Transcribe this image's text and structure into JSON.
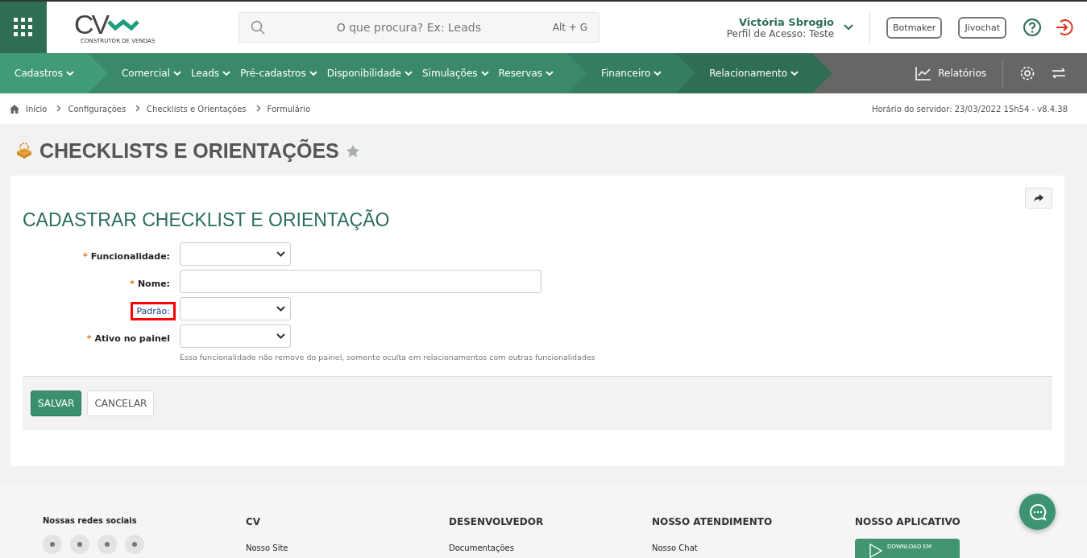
{
  "header": {
    "logo": {
      "letters": "CV",
      "tagline": "CONSTRUTOR DE VENDAS"
    },
    "search": {
      "placeholder": "O que procura? Ex: Leads",
      "shortcut": "Alt + G"
    },
    "user": {
      "name": "Victória Sbrogio",
      "profile": "Perfil de Acesso: Teste"
    },
    "buttons": [
      "Botmaker",
      "Jivochat"
    ]
  },
  "nav": {
    "groups": [
      {
        "color": "#409b76",
        "items": [
          "Cadastros"
        ]
      },
      {
        "color": "#3a8a69",
        "items": [
          "Comercial",
          "Leads",
          "Pré-cadastros",
          "Disponibilidade",
          "Simulações",
          "Reservas"
        ]
      },
      {
        "color": "#357d60",
        "items": [
          "Financeiro"
        ]
      },
      {
        "color": "#2e6e54",
        "items": [
          "Relacionamento"
        ]
      }
    ],
    "reports": "Relatórios"
  },
  "breadcrumb": {
    "items": [
      "Início",
      "Configurações",
      "Checklists e Orientações",
      "Formulário"
    ],
    "server_time": "Horário do servidor: 23/03/2022 15h54 - v8.4.38"
  },
  "page": {
    "title": "CHECKLISTS E ORIENTAÇÕES",
    "favorite": false
  },
  "form": {
    "title": "CADASTRAR CHECKLIST E ORIENTAÇÃO",
    "required_mark": "*",
    "fields": [
      {
        "label": "Funcionalidade:",
        "kind": "select",
        "required": true,
        "highlighted": false
      },
      {
        "label": "Nome:",
        "kind": "text",
        "required": true,
        "highlighted": false
      },
      {
        "label": "Padrão:",
        "kind": "select",
        "required": false,
        "highlighted": true
      },
      {
        "label": "Ativo no painel",
        "kind": "select",
        "required": true,
        "highlighted": false,
        "help": "Essa funcionalidade não remove do painel, somente oculta em relacionamentos com outras funcionalidades"
      }
    ],
    "buttons": [
      {
        "label": "SALVAR",
        "kind": "primary"
      },
      {
        "label": "CANCELAR",
        "kind": "secondary"
      }
    ]
  },
  "footer": {
    "social_title": "Nossas redes sociais",
    "columns": [
      {
        "title": "CV",
        "links": [
          "Nosso Site"
        ]
      },
      {
        "title": "DESENVOLVEDOR",
        "links": [
          "Documentações"
        ]
      },
      {
        "title": "NOSSO ATENDIMENTO",
        "links": [
          "Nosso Chat"
        ]
      },
      {
        "title": "NOSSO APLICATIVO",
        "badge": "DOWNLOAD EM"
      }
    ]
  }
}
